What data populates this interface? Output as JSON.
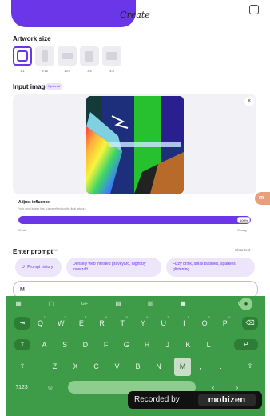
{
  "header": {
    "title": "Create"
  },
  "artwork": {
    "label": "Artwork size",
    "options": [
      {
        "label": "1:1"
      },
      {
        "label": "9:16"
      },
      {
        "label": "16:9"
      },
      {
        "label": "3:4"
      },
      {
        "label": "4:3"
      }
    ]
  },
  "input_image": {
    "label": "Input image",
    "badge": "Optional",
    "close_glyph": "×"
  },
  "influence": {
    "title": "Adjust influence",
    "description": "Your input image has a large effect on the final artwork.",
    "value_fraction": 1.0,
    "value_label": "100%",
    "min_label": "Weak",
    "max_label": "Strong"
  },
  "prompt": {
    "label": "Enter prompt",
    "count": "0/2000",
    "clear_label": "Clear text",
    "history_icon": "↺",
    "history_label": "Prompt history",
    "suggestions": [
      "Densely web infested graveyard, night by lovecraft",
      "Fizzy drink, small bubbles, sparkles, glistening"
    ],
    "input_value": "M"
  },
  "side_handle": {
    "label": "m"
  },
  "keyboard": {
    "toolbar_icons": [
      {
        "name": "apps-grid-icon",
        "glyph": "▦"
      },
      {
        "name": "sticker-icon",
        "glyph": "▢"
      },
      {
        "name": "gif-icon",
        "glyph": "GIF"
      },
      {
        "name": "clipboard-icon",
        "glyph": "▤"
      },
      {
        "name": "text-edit-icon",
        "glyph": "▥"
      },
      {
        "name": "emoji-board-icon",
        "glyph": "▣"
      },
      {
        "name": "settings-icon",
        "glyph": "⚙"
      }
    ],
    "mic_glyph": "●",
    "row1": [
      {
        "k": "Q",
        "s": "1"
      },
      {
        "k": "W",
        "s": "2"
      },
      {
        "k": "E",
        "s": "3"
      },
      {
        "k": "R",
        "s": "4"
      },
      {
        "k": "T",
        "s": "5"
      },
      {
        "k": "Y",
        "s": "6"
      },
      {
        "k": "U",
        "s": "7"
      },
      {
        "k": "I",
        "s": "8"
      },
      {
        "k": "O",
        "s": "9"
      },
      {
        "k": "P",
        "s": "0"
      }
    ],
    "row2": [
      "A",
      "S",
      "D",
      "F",
      "G",
      "H",
      "J",
      "K",
      "L"
    ],
    "row3": [
      "Z",
      "X",
      "C",
      "V",
      "B",
      "N",
      "M"
    ],
    "tab_glyph": "⇥",
    "backspace_glyph": "⌫",
    "capslock_glyph": "⇧",
    "enter_glyph": "↵",
    "shift_glyph": "⇧",
    "numbers_label": "?123",
    "emoji_glyph": "☺",
    "comma": ",",
    "period": ".",
    "left_glyph": "‹",
    "right_glyph": "›"
  },
  "recording": {
    "text": "Recorded by",
    "logo": "mobizen"
  }
}
